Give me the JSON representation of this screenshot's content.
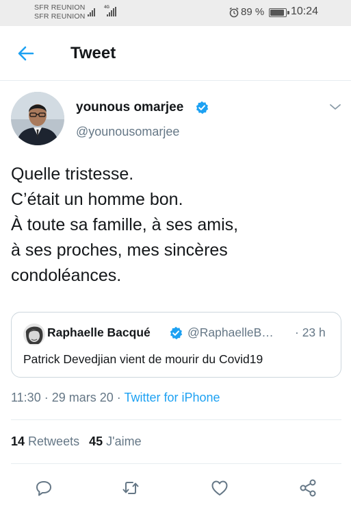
{
  "status_bar": {
    "carrier_1": "SFR REUNION",
    "carrier_2": "SFR REUNION",
    "network": "4G",
    "battery_percent": "89 %",
    "battery_level": 0.89,
    "time": "10:24",
    "icons": [
      "signal-icon",
      "alarm-icon",
      "battery-icon"
    ]
  },
  "header": {
    "title": "Tweet",
    "back_icon": "back-arrow-icon"
  },
  "tweet": {
    "author_name": "younous omarjee",
    "author_handle": "@younousomarjee",
    "verified": true,
    "text": "Quelle tristesse.\nC’était un homme bon.\nÀ toute sa famille, à ses amis,\nà ses proches, mes sincères\ncondoléances.",
    "time": "11:30",
    "separator": " · ",
    "date": "29 mars 20",
    "source": "Twitter for iPhone"
  },
  "quoted_tweet": {
    "author_name": "Raphaelle Bacqué",
    "author_handle": "@RaphaelleB…",
    "verified": true,
    "time": "· 23 h",
    "text": "Patrick Devedjian vient de mourir du Covid19"
  },
  "stats": {
    "retweets_count": "14",
    "retweets_label": "Retweets",
    "likes_count": "45",
    "likes_label": "J'aime"
  },
  "actions": [
    "reply-icon",
    "retweet-icon",
    "like-icon",
    "share-icon"
  ],
  "colors": {
    "accent": "#1da1f2",
    "secondary_text": "#657786",
    "primary_text": "#14171a",
    "status_bar_bg": "#ededed"
  }
}
